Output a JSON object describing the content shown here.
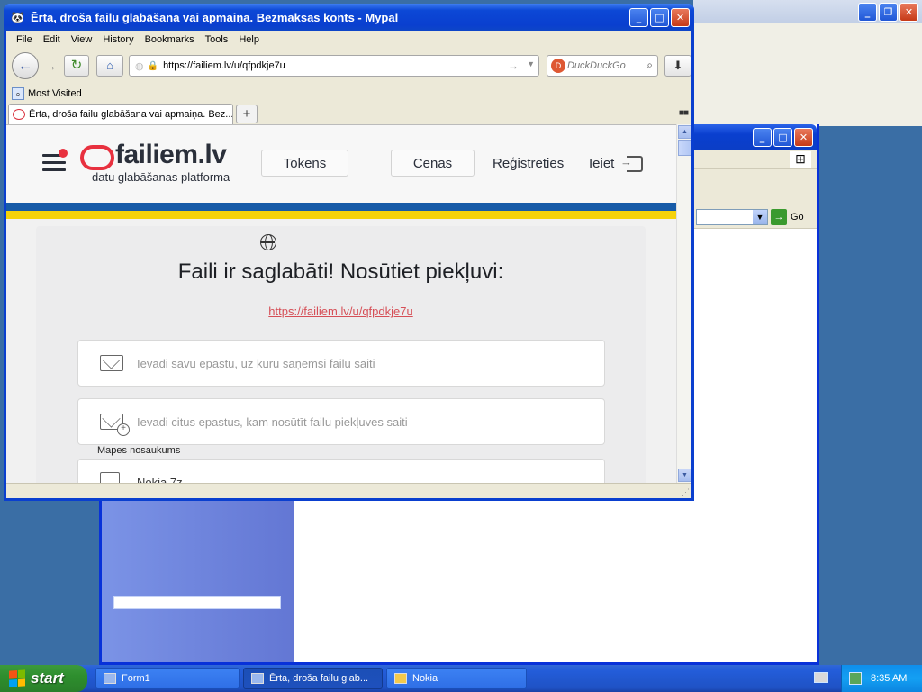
{
  "browser": {
    "window_title": "Ērta, droša failu glabāšana vai apmaiņa. Bezmaksas konts - Mypal",
    "menu": [
      "File",
      "Edit",
      "View",
      "History",
      "Bookmarks",
      "Tools",
      "Help"
    ],
    "url": "https://failiem.lv/u/qfpdkje7u",
    "search_placeholder": "DuckDuckGo",
    "bookmarks_item": "Most Visited",
    "tab_title": "Ērta, droša failu glabāšana vai apmaiņa. Bez..."
  },
  "site": {
    "logo": "failiem.lv",
    "logo_tagline": "datu glabāšanas platforma",
    "nav_tokens": "Tokens",
    "nav_prices": "Cenas",
    "nav_register": "Reģistrēties",
    "nav_login": "Ieiet",
    "heading": "Faili ir saglabāti! Nosūtiet piekļuvi:",
    "share_link": "https://failiem.lv/u/qfpdkje7u",
    "email_own_placeholder": "Ievadi savu epastu, uz kuru saņemsi failu saiti",
    "email_others_placeholder": "Ievadi citus epastus, kam nosūtīt failu piekļuves saiti",
    "folder_label": "Mapes nosaukums",
    "folder_value": "Nokia 7z"
  },
  "explorer": {
    "go_label": "Go"
  },
  "taskbar": {
    "start_label": "start",
    "items": [
      "Form1",
      "Ērta, droša failu glab...",
      "Nokia"
    ],
    "clock": "8:35 AM"
  },
  "colors": {
    "accent_red": "#e8313f",
    "flag_blue": "#175ba8",
    "flag_yellow": "#f5d20b",
    "xp_blue": "#0a3fcf"
  }
}
